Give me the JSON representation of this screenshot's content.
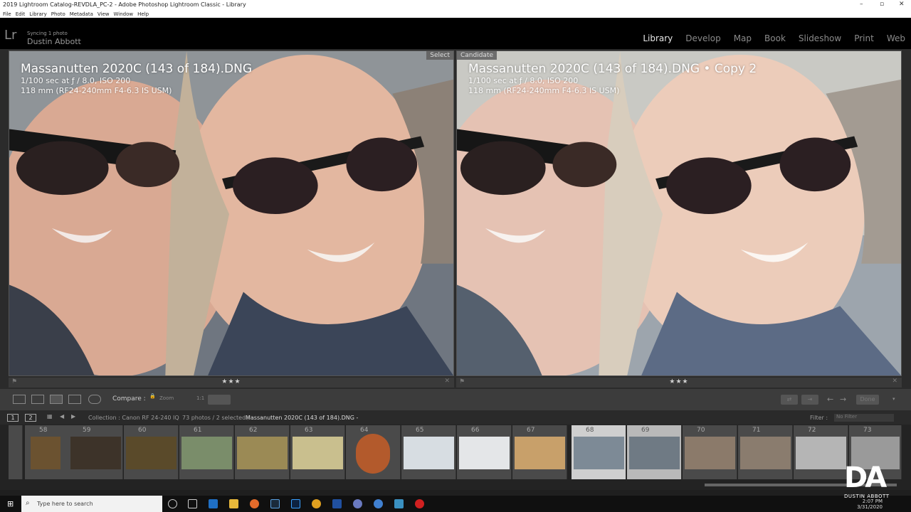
{
  "window": {
    "title": "2019 Lightroom Catalog-REVDLA_PC-2 - Adobe Photoshop Lightroom Classic - Library"
  },
  "menu": [
    "File",
    "Edit",
    "Library",
    "Photo",
    "Metadata",
    "View",
    "Window",
    "Help"
  ],
  "header": {
    "logo": "Lr",
    "sync": "Syncing 1 photo",
    "identity": "Dustin Abbott"
  },
  "modules": [
    "Library",
    "Develop",
    "Map",
    "Book",
    "Slideshow",
    "Print",
    "Web"
  ],
  "active_module": "Library",
  "left_pane": {
    "tag": "Select",
    "filename": "Massanutten 2020C (143 of 184).DNG",
    "exposure": "1/100 sec at ƒ / 8.0, ISO 200",
    "lens": "118 mm (RF24-240mm F4-6.3 IS USM)",
    "stars": "★★★"
  },
  "right_pane": {
    "tag": "Candidate",
    "filename": "Massanutten 2020C (143 of 184).DNG • Copy 2",
    "exposure": "1/100 sec at ƒ / 8.0, ISO 200",
    "lens": "118 mm (RF24-240mm F4-6.3 IS USM)",
    "stars": "★★★"
  },
  "toolbar": {
    "compare_label": "Compare :",
    "zoom_label": "Zoom",
    "zoom_value": "1:1",
    "done_label": "Done"
  },
  "filmstrip_header": {
    "page1": "1",
    "page2": "2",
    "collection": "Collection : Canon RF 24-240 IQ",
    "count": "73 photos / 2 selected /",
    "current": "Massanutten 2020C (143 of 184).DNG -",
    "filter_label": "Filter :",
    "filter_value": "No Filter"
  },
  "thumbnails": [
    {
      "num": "58",
      "color": "#6b5230"
    },
    {
      "num": "59",
      "color": "#3d3329"
    },
    {
      "num": "60",
      "color": "#5a4a2a"
    },
    {
      "num": "61",
      "color": "#7a8d6a"
    },
    {
      "num": "62",
      "color": "#9b8a55"
    },
    {
      "num": "63",
      "color": "#c9bf8e"
    },
    {
      "num": "64",
      "color": "#b35a2c"
    },
    {
      "num": "65",
      "color": "#d7dde2"
    },
    {
      "num": "66",
      "color": "#e4e6e8"
    },
    {
      "num": "67",
      "color": "#c8a06a"
    },
    {
      "num": "68",
      "color": "#7d8a96"
    },
    {
      "num": "69",
      "color": "#6f7a84"
    },
    {
      "num": "70",
      "color": "#8b7a6a"
    },
    {
      "num": "71",
      "color": "#8a7c6e"
    },
    {
      "num": "72",
      "color": "#b5b5b5"
    },
    {
      "num": "73",
      "color": "#9a9a9a"
    }
  ],
  "taskbar": {
    "search_placeholder": "Type here to search",
    "time": "2:07 PM",
    "date": "3/31/2020"
  },
  "watermark": {
    "big": "DA",
    "small": "DUSTIN ABBOTT"
  }
}
